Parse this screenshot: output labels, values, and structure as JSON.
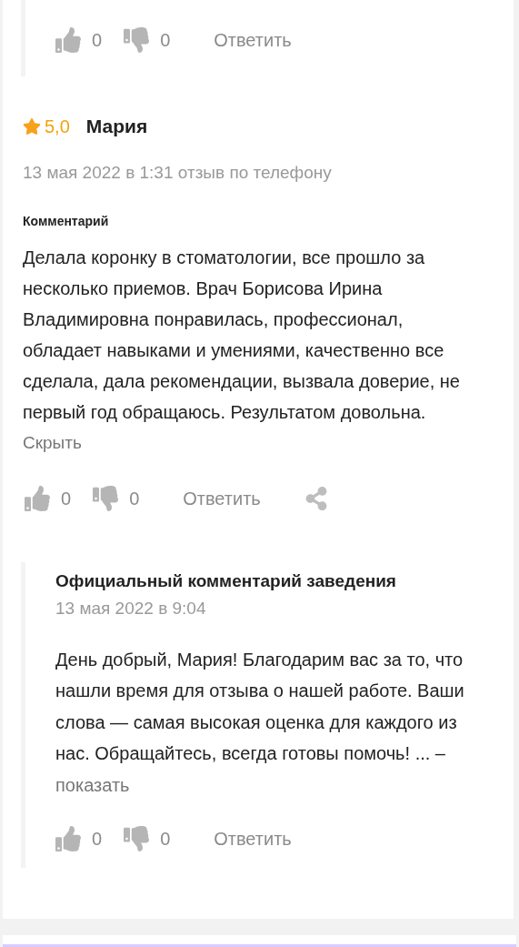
{
  "previous_reply": {
    "actions": {
      "likes": "0",
      "dislikes": "0",
      "reply": "Ответить"
    }
  },
  "review": {
    "rating": "5,0",
    "author": "Мария",
    "meta": "13 мая 2022 в 1:31 отзыв по телефону",
    "comment_label": "Комментарий",
    "text": "Делала коронку в стоматологии, все прошло за несколько приемов. Врач Борисова Ирина Владимировна понравилась, профессионал, обладает навыками и умениями, качественно все сделала, дала рекомендации, вызвала доверие, не первый год обращаюсь. Результатом довольна.",
    "hide_link": "Скрыть",
    "actions": {
      "likes": "0",
      "dislikes": "0",
      "reply": "Ответить"
    }
  },
  "official_reply": {
    "title": "Официальный комментарий заведения",
    "date": "13 мая 2022 в 9:04",
    "text": "День добрый, Мария! Благодарим вас за то, что нашли время для отзыва о нашей работе. Ваши слова — самая высокая оценка для каждого из нас. Обращайтесь, всегда готовы помочь! ... –",
    "more_link": "показать",
    "actions": {
      "likes": "0",
      "dislikes": "0",
      "reply": "Ответить"
    }
  }
}
